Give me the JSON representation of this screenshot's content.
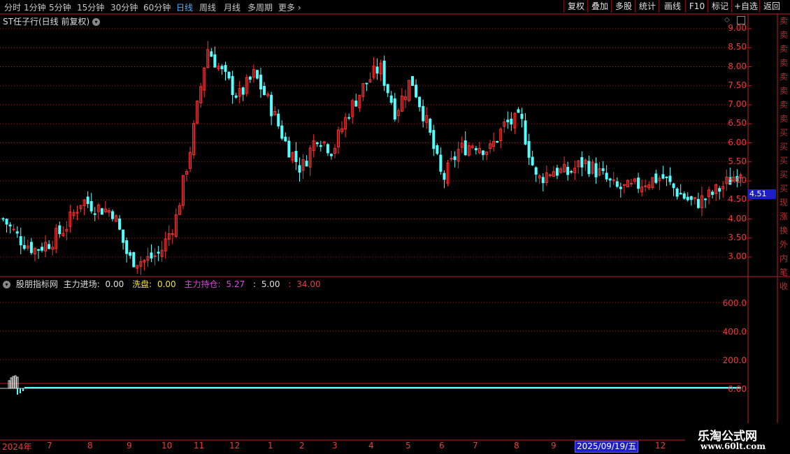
{
  "toolbar": {
    "period_tabs": [
      "分时",
      "1分钟",
      "5分钟",
      "15分钟",
      "30分钟",
      "60分钟",
      "日线",
      "周线",
      "月线",
      "多周期",
      "更多"
    ],
    "active_tab": "日线",
    "more_chevron": "chevron-right-icon",
    "right_buttons": [
      "复权",
      "叠加",
      "多股",
      "统计",
      "画线",
      "F10",
      "标记",
      "+自选",
      "返回"
    ]
  },
  "main_chart": {
    "title": "ST任子行(日线 前复权)",
    "price_ticks": [
      "9.00",
      "8.50",
      "8.00",
      "7.50",
      "7.00",
      "6.50",
      "6.00",
      "5.50",
      "5.00",
      "4.51",
      "4.50",
      "4.00",
      "3.50",
      "3.00"
    ],
    "cursor_price": "4.51"
  },
  "indicator": {
    "name": "股朋指标网",
    "items": [
      {
        "label": "主力进场:",
        "value": "0.00",
        "color": "#e0e0e0"
      },
      {
        "label": "洗盘:",
        "value": "0.00",
        "color": "#f0e040"
      },
      {
        "label": "主力持仓:",
        "value": "5.27",
        "color": "#e040e0"
      },
      {
        "label": ":",
        "value": "5.00",
        "color": "#e0e0e0"
      },
      {
        "label": ":",
        "value": "34.00",
        "color": "#e04040"
      }
    ],
    "ticks": [
      "600.0",
      "400.0",
      "200.0",
      "0.00"
    ]
  },
  "x_axis": {
    "labels": [
      "2024年",
      "7",
      "8",
      "9",
      "10",
      "11",
      "12",
      "1",
      "2",
      "3",
      "4",
      "5",
      "6",
      "7",
      "8",
      "9",
      "12"
    ],
    "cursor_date": "2025/09/19/五"
  },
  "watermark": {
    "line1": "乐淘公式网",
    "line2": "www.60lt.com"
  },
  "side_panel_chars": [
    "卖",
    "卖",
    "卖",
    "卖",
    "卖",
    "卖",
    "卖",
    "卖",
    "买",
    "买",
    "买",
    "买",
    "买",
    "现",
    "涨",
    "换",
    "外",
    "内",
    "笔",
    "收"
  ],
  "colors": {
    "up": "#ff3030",
    "down": "#54ffff",
    "grid": "#8b1a1a",
    "axis": "#c02020",
    "active_tab": "#4fb0ff"
  },
  "chart_data": {
    "type": "candlestick",
    "ylim": [
      2.8,
      9.2
    ],
    "x": [
      "2024年",
      "7",
      "8",
      "9",
      "10",
      "11",
      "12",
      "1",
      "2",
      "3",
      "4",
      "5",
      "6",
      "7",
      "8",
      "9",
      "12"
    ],
    "close_path": [
      4.0,
      3.5,
      3.2,
      3.4,
      3.8,
      4.5,
      4.3,
      4.2,
      2.95,
      2.9,
      3.1,
      4.0,
      6.0,
      8.5,
      7.8,
      7.2,
      7.8,
      7.0,
      6.0,
      5.3,
      6.2,
      5.8,
      6.8,
      7.5,
      8.0,
      6.8,
      7.7,
      6.5,
      5.0,
      5.8,
      6.0,
      5.8,
      6.5,
      6.6,
      5.0,
      5.3,
      5.2,
      5.5,
      5.2,
      4.8,
      4.8,
      5.0,
      5.1,
      4.7,
      4.4,
      4.6,
      4.9,
      5.3
    ]
  }
}
